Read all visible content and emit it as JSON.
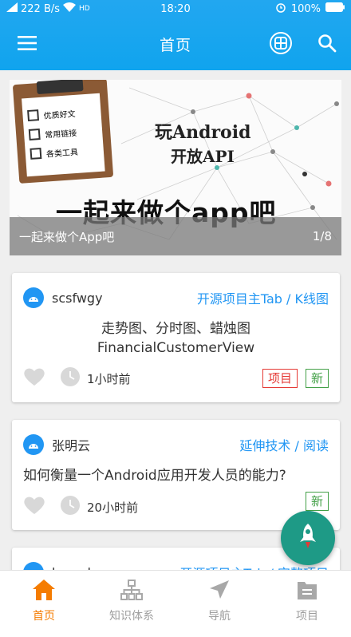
{
  "status_bar": {
    "network_speed": "222 B/s",
    "time": "18:20",
    "battery": "100%"
  },
  "toolbar": {
    "title": "首页"
  },
  "banner": {
    "image_text_line1": "玩Android",
    "image_text_line2": "开放API",
    "image_slogan": "一起来做个app吧",
    "clipboard_items": [
      "优质好文",
      "常用链接",
      "各类工具"
    ],
    "caption": "一起来做个App吧",
    "page_indicator": "1/8"
  },
  "articles": [
    {
      "author": "scsfwgy",
      "chapter": "开源项目主Tab / K线图",
      "title_line1": "走势图、分时图、蜡烛图",
      "title_line2": "FinancialCustomerView",
      "time": "1小时前",
      "tags": [
        "项目",
        "新"
      ]
    },
    {
      "author": "张明云",
      "chapter": "延伸技术 / 阅读",
      "title_line1": "如何衡量一个Android应用开发人员的能力?",
      "time": "20小时前",
      "tags": [
        "新"
      ]
    },
    {
      "author": "kongdongpu",
      "chapter": "开源项目主Tab / 完整项目"
    }
  ],
  "bottom_nav": [
    {
      "label": "首页",
      "icon": "home-icon",
      "active": true
    },
    {
      "label": "知识体系",
      "icon": "tree-icon",
      "active": false
    },
    {
      "label": "导航",
      "icon": "navigation-icon",
      "active": false
    },
    {
      "label": "项目",
      "icon": "project-icon",
      "active": false
    }
  ],
  "colors": {
    "primary": "#10a4ee",
    "accent": "#f57c00",
    "fab": "#1e9a86",
    "tag_red": "#e53935",
    "tag_green": "#43a047",
    "link": "#2196f3"
  }
}
